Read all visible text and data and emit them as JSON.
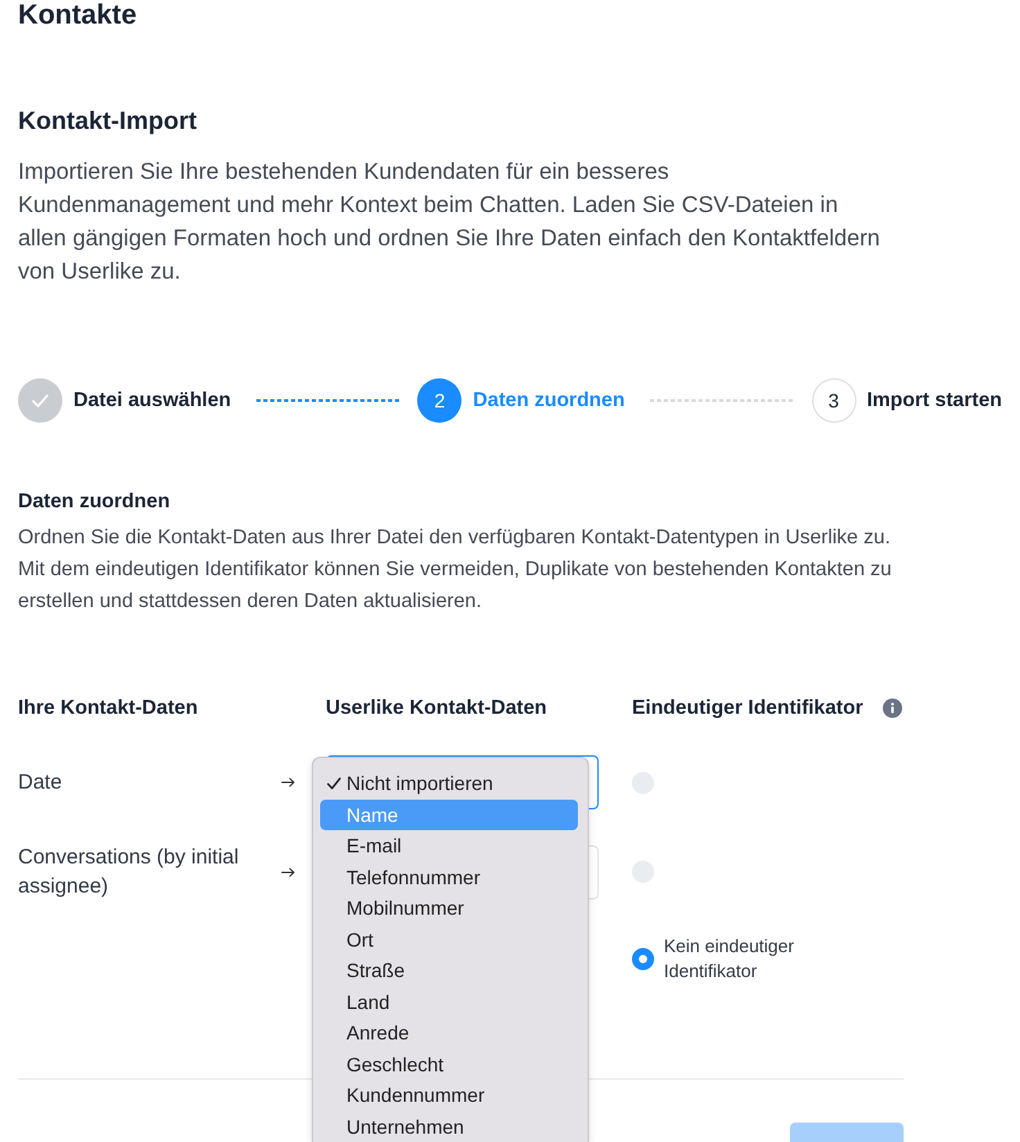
{
  "page_title": "Kontakte",
  "section": {
    "title": "Kontakt-Import",
    "description": "Importieren Sie Ihre bestehenden Kundendaten für ein besseres Kundenmanagement und mehr Kontext beim Chatten. Laden Sie CSV-Dateien in allen gängigen Formaten hoch und ordnen Sie Ihre Daten einfach den Kontaktfeldern von Userlike zu."
  },
  "steps": [
    {
      "label": "Datei auswählen",
      "completed": true,
      "current": false
    },
    {
      "number": "2",
      "label": "Daten zuordnen",
      "completed": false,
      "current": true
    },
    {
      "number": "3",
      "label": "Import starten",
      "completed": false,
      "current": false
    }
  ],
  "mapping": {
    "title": "Daten zuordnen",
    "description": "Ordnen Sie die Kontakt-Daten aus Ihrer Datei den verfügbaren Kontakt-Datentypen in Userlike zu. Mit dem eindeutigen Identifikator können Sie vermeiden, Duplikate von bestehenden Kontakten zu erstellen und stattdessen deren Daten aktualisieren.",
    "columns": [
      "Ihre Kontakt-Daten",
      "Userlike Kontakt-Daten",
      "Eindeutiger Identifikator"
    ],
    "rows": [
      {
        "source": "Date",
        "focused": true,
        "identifier": {
          "selected": false,
          "disabled": true
        },
        "dropdown": {
          "options": [
            {
              "label": "Nicht importieren",
              "selected": true,
              "highlighted": false
            },
            {
              "label": "Name",
              "selected": false,
              "highlighted": true
            },
            {
              "label": "E-mail",
              "selected": false,
              "highlighted": false
            },
            {
              "label": "Telefonnummer",
              "selected": false,
              "highlighted": false
            },
            {
              "label": "Mobilnummer",
              "selected": false,
              "highlighted": false
            },
            {
              "label": "Ort",
              "selected": false,
              "highlighted": false
            },
            {
              "label": "Straße",
              "selected": false,
              "highlighted": false
            },
            {
              "label": "Land",
              "selected": false,
              "highlighted": false
            },
            {
              "label": "Anrede",
              "selected": false,
              "highlighted": false
            },
            {
              "label": "Geschlecht",
              "selected": false,
              "highlighted": false
            },
            {
              "label": "Kundennummer",
              "selected": false,
              "highlighted": false
            },
            {
              "label": "Unternehmen",
              "selected": false,
              "highlighted": false
            }
          ]
        }
      },
      {
        "source": "Conversations (by initial assignee)",
        "focused": false,
        "identifier": {
          "selected": false,
          "disabled": true
        }
      }
    ],
    "no_identifier": {
      "label": "Kein eindeutiger Identifikator",
      "selected": true
    }
  },
  "footer_button": {
    "disabled": true
  }
}
